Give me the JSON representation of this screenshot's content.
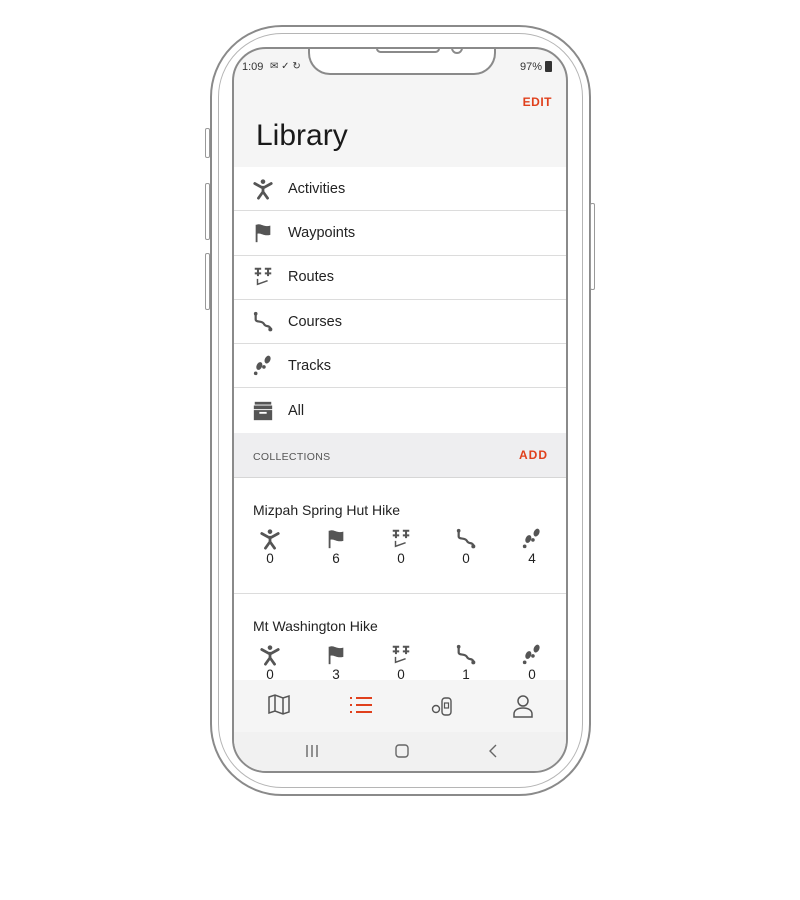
{
  "status_bar": {
    "time": "1:09",
    "battery": "97%"
  },
  "header": {
    "edit_label": "EDIT",
    "title": "Library"
  },
  "library_items": [
    {
      "label": "Activities",
      "icon": "activity-person-icon"
    },
    {
      "label": "Waypoints",
      "icon": "flag-icon"
    },
    {
      "label": "Routes",
      "icon": "route-pins-icon"
    },
    {
      "label": "Courses",
      "icon": "course-path-icon"
    },
    {
      "label": "Tracks",
      "icon": "footprints-icon"
    },
    {
      "label": "All",
      "icon": "archive-box-icon"
    }
  ],
  "collections": {
    "header": "COLLECTIONS",
    "add_label": "ADD",
    "items": [
      {
        "name": "Mizpah Spring Hut Hike",
        "counts": {
          "activities": "0",
          "waypoints": "6",
          "routes": "0",
          "courses": "0",
          "tracks": "4"
        }
      },
      {
        "name": "Mt Washington Hike",
        "counts": {
          "activities": "0",
          "waypoints": "3",
          "routes": "0",
          "courses": "1",
          "tracks": "0"
        }
      }
    ]
  },
  "bottom_nav": {
    "active": "library",
    "items": [
      "map-icon",
      "library-list-icon",
      "devices-icon",
      "profile-icon"
    ]
  },
  "colors": {
    "accent": "#e0401c",
    "icon": "#555555"
  }
}
